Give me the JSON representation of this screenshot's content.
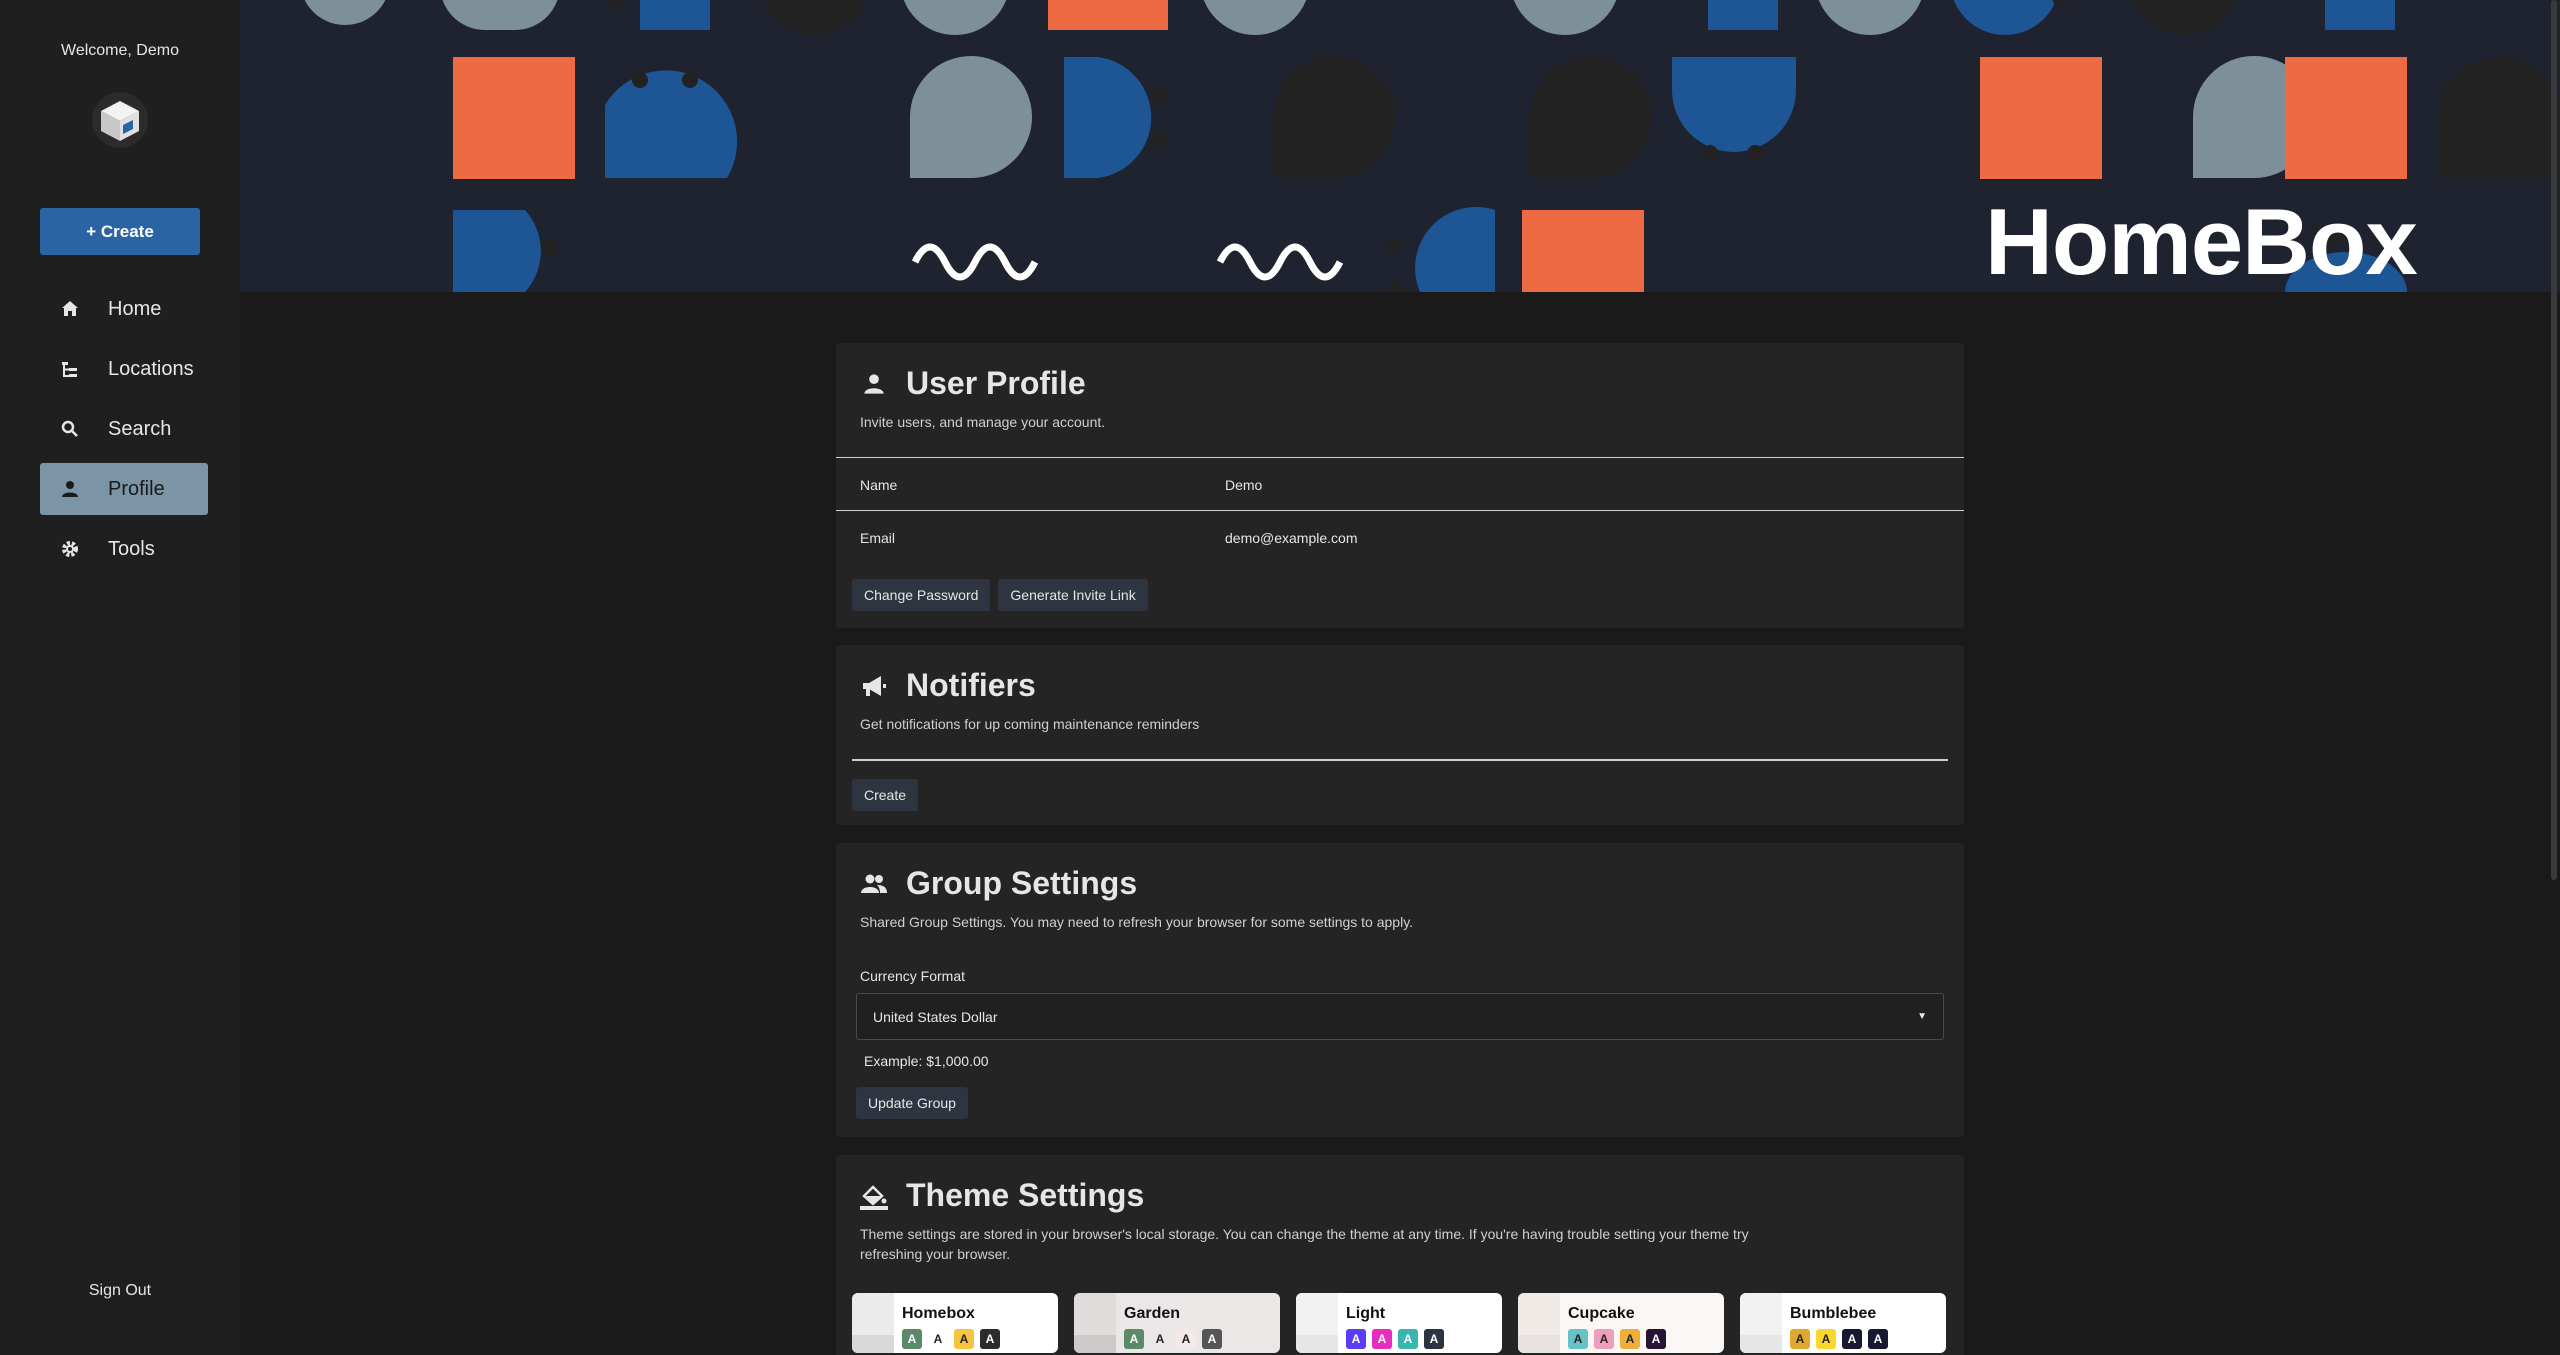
{
  "sidebar": {
    "welcome": "Welcome, Demo",
    "create_label": "+ Create",
    "items": [
      {
        "label": "Home",
        "icon": "home-icon"
      },
      {
        "label": "Locations",
        "icon": "tree-icon"
      },
      {
        "label": "Search",
        "icon": "search-icon"
      },
      {
        "label": "Profile",
        "icon": "user-icon",
        "active": true
      },
      {
        "label": "Tools",
        "icon": "gear-icon"
      }
    ],
    "sign_out": "Sign Out"
  },
  "banner": {
    "brand": "HomeBox"
  },
  "profile": {
    "title": "User Profile",
    "subtitle": "Invite users, and manage your account.",
    "fields": [
      {
        "label": "Name",
        "value": "Demo"
      },
      {
        "label": "Email",
        "value": "demo@example.com"
      }
    ],
    "buttons": [
      "Change Password",
      "Generate Invite Link"
    ]
  },
  "notifiers": {
    "title": "Notifiers",
    "subtitle": "Get notifications for up coming maintenance reminders",
    "create_label": "Create"
  },
  "group": {
    "title": "Group Settings",
    "subtitle": "Shared Group Settings. You may need to refresh your browser for some settings to apply.",
    "currency_label": "Currency Format",
    "currency_value": "United States Dollar",
    "example": "Example: $1,000.00",
    "update_label": "Update Group"
  },
  "theme": {
    "title": "Theme Settings",
    "subtitle": "Theme settings are stored in your browser's local storage. You can change the theme at any time. If you're having trouble setting your theme try refreshing your browser.",
    "themes": [
      {
        "name": "Homebox",
        "swatches": [
          "#5a8a6a",
          "#ffffff",
          "#f5c542",
          "#2b2b2b"
        ]
      },
      {
        "name": "Garden",
        "swatches": [
          "#5a8a6a",
          "#ffffff",
          "#f4e8e8",
          "#555555"
        ]
      },
      {
        "name": "Light",
        "swatches": [
          "#5b3df5",
          "#e62ebd",
          "#36b8b0",
          "#2b3440"
        ]
      },
      {
        "name": "Cupcake",
        "swatches": [
          "#65c3c8",
          "#ef9fbc",
          "#eeaf3a",
          "#291334"
        ]
      },
      {
        "name": "Bumblebee",
        "swatches": [
          "#e0a82e",
          "#f9d72f",
          "#181830",
          "#181830"
        ]
      }
    ],
    "swatch_letter": "A"
  },
  "colors": {
    "accent": "#2b64a5",
    "active_nav": "#7b95a6",
    "banner_orange": "#ee6a43",
    "banner_blue": "#1e5594",
    "banner_gray": "#7d9099"
  }
}
